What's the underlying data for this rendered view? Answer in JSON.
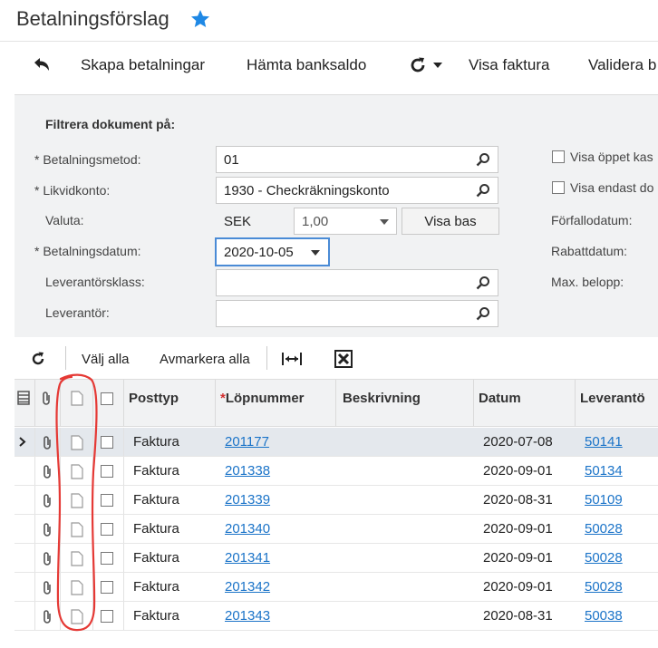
{
  "header": {
    "title": "Betalningsförslag"
  },
  "toolbar": {
    "create_payments": "Skapa betalningar",
    "fetch_bank_balance": "Hämta banksaldo",
    "show_invoice": "Visa faktura",
    "validate": "Validera b"
  },
  "filter": {
    "heading": "Filtrera dokument på:",
    "payment_method": {
      "label": "Betalningsmetod:",
      "value": "01"
    },
    "cash_account": {
      "label": "Likvidkonto:",
      "value": "1930 - Checkräkningskonto"
    },
    "currency": {
      "label": "Valuta:",
      "code": "SEK",
      "rate": "1,00",
      "view_base": "Visa bas"
    },
    "payment_date": {
      "label": "Betalningsdatum:",
      "value": "2020-10-05"
    },
    "vendor_class": {
      "label": "Leverantörsklass:",
      "value": ""
    },
    "vendor": {
      "label": "Leverantör:",
      "value": ""
    },
    "show_open_label": "Visa öppet kas",
    "show_only_label": "Visa endast do",
    "due_date_label": "Förfallodatum:",
    "discount_date_label": "Rabattdatum:",
    "max_amount_label": "Max. belopp:"
  },
  "grid_toolbar": {
    "select_all": "Välj alla",
    "deselect_all": "Avmarkera alla"
  },
  "columns": {
    "type": "Posttyp",
    "ref_required": "*",
    "ref": "Löpnummer",
    "description": "Beskrivning",
    "date": "Datum",
    "vendor": "Leverantö"
  },
  "rows": [
    {
      "type": "Faktura",
      "ref": "201177",
      "date": "2020-07-08",
      "vendor": "50141",
      "active": true
    },
    {
      "type": "Faktura",
      "ref": "201338",
      "date": "2020-09-01",
      "vendor": "50134"
    },
    {
      "type": "Faktura",
      "ref": "201339",
      "date": "2020-08-31",
      "vendor": "50109"
    },
    {
      "type": "Faktura",
      "ref": "201340",
      "date": "2020-09-01",
      "vendor": "50028"
    },
    {
      "type": "Faktura",
      "ref": "201341",
      "date": "2020-09-01",
      "vendor": "50028"
    },
    {
      "type": "Faktura",
      "ref": "201342",
      "date": "2020-09-01",
      "vendor": "50028"
    },
    {
      "type": "Faktura",
      "ref": "201343",
      "date": "2020-08-31",
      "vendor": "50038"
    }
  ],
  "colors": {
    "accent": "#1a73c8",
    "star": "#1e88e5",
    "annotation": "#e53935",
    "active_row": "#e4e8ed"
  }
}
